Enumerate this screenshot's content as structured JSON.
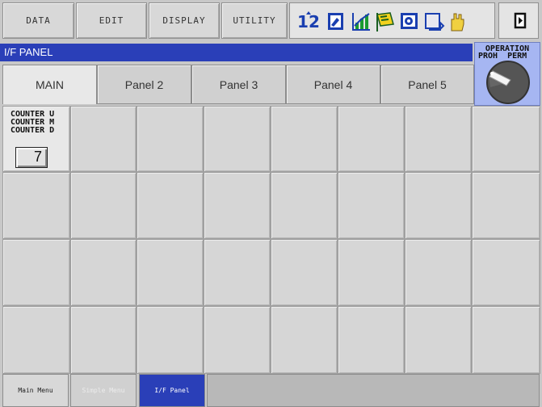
{
  "menubar": {
    "items": [
      {
        "label": "DATA"
      },
      {
        "label": "EDIT"
      },
      {
        "label": "DISPLAY"
      },
      {
        "label": "UTILITY"
      }
    ],
    "status_icons": [
      "coordinate-icon",
      "edit-lock-icon",
      "chart-icon",
      "run-flag-icon",
      "camera-icon",
      "cycle-icon",
      "hand-icon"
    ],
    "play_icon": "play-icon"
  },
  "window": {
    "title": "I/F PANEL"
  },
  "operation_key": {
    "title": "OPERATION",
    "subtitle": "PROH  PERM",
    "state": "PERM"
  },
  "tabs": [
    {
      "label": "MAIN",
      "active": true
    },
    {
      "label": "Panel 2",
      "active": false
    },
    {
      "label": "Panel 3",
      "active": false
    },
    {
      "label": "Panel 4",
      "active": false
    },
    {
      "label": "Panel 5",
      "active": false
    }
  ],
  "grid": {
    "rows": 4,
    "cols": 8,
    "counter": {
      "lines": [
        "COUNTER U",
        "COUNTER M",
        "COUNTER D"
      ],
      "value": "7"
    }
  },
  "taskbar": [
    {
      "label": "Main Menu"
    },
    {
      "label": "Simple Menu"
    },
    {
      "label": "I/F Panel"
    }
  ]
}
